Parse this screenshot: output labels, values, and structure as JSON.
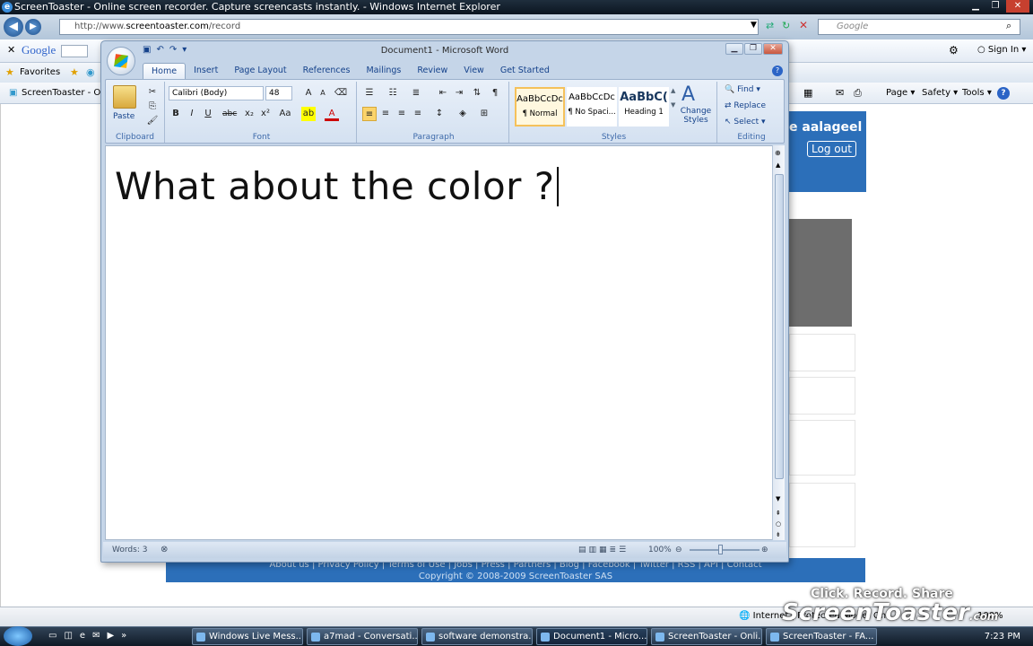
{
  "ie": {
    "title": "ScreenToaster - Online screen recorder. Capture screencasts instantly. - Windows Internet Explorer",
    "url_prefix": "http://www.",
    "url_domain": "screentoaster.com",
    "url_path": "/record",
    "search_placeholder": "Google",
    "google_label": "Google",
    "sign_in": "Sign In",
    "favorites": "Favorites",
    "tab_label": "ScreenToaster - Onli...",
    "page_menu": "Page",
    "safety_menu": "Safety",
    "tools_menu": "Tools",
    "help_icon": "?"
  },
  "webpage": {
    "user_text": "e aalageel",
    "logout": "Log out",
    "footer_links": "About us | Privacy Policy | Terms of Use | Jobs | Press | Partners | Blog | Facebook | Twitter | RSS | API | Contact",
    "copyright": "Copyright © 2008-2009 ScreenToaster SAS"
  },
  "word": {
    "title": "Document1 - Microsoft Word",
    "tabs": [
      "Home",
      "Insert",
      "Page Layout",
      "References",
      "Mailings",
      "Review",
      "View",
      "Get Started"
    ],
    "clipboard": {
      "paste": "Paste",
      "label": "Clipboard"
    },
    "font": {
      "name": "Calibri (Body)",
      "size": "48",
      "label": "Font"
    },
    "paragraph": {
      "label": "Paragraph"
    },
    "styles": {
      "label": "Styles",
      "items": [
        {
          "preview": "AaBbCcDc",
          "name": "¶ Normal"
        },
        {
          "preview": "AaBbCcDc",
          "name": "¶ No Spaci..."
        },
        {
          "preview": "AaBbC(",
          "name": "Heading 1"
        }
      ],
      "change_styles": "Change Styles"
    },
    "editing": {
      "find": "Find",
      "replace": "Replace",
      "select": "Select",
      "label": "Editing"
    },
    "document_text": "What about the color ?",
    "status_words": "Words: 3",
    "zoom": "100%"
  },
  "status": {
    "zone": "Internet | Protected Mode: On",
    "zoom": "100%"
  },
  "taskbar": {
    "items": [
      "Windows Live Mess...",
      "a7mad - Conversati...",
      "software demonstra...",
      "Document1 - Micro...",
      "ScreenToaster - Onli...",
      "ScreenToaster - FA..."
    ],
    "time": "7:23 PM"
  },
  "watermark": {
    "line1": "Click. Record. Share",
    "line2": "ScreenToaster",
    "suffix": ".com"
  }
}
